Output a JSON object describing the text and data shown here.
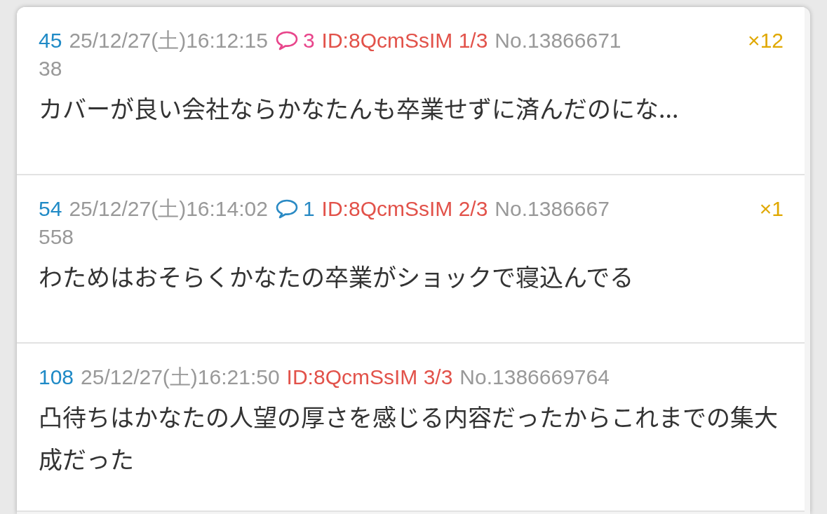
{
  "posts": [
    {
      "number": "45",
      "date": "25/12/27(土)16:12:15",
      "replies": {
        "count": "3",
        "color": "#e8458b"
      },
      "id": "ID:8QcmSsIM",
      "id_count": "1/3",
      "no": "No.13866671",
      "no_rest": "38",
      "badge": "×12",
      "body": "カバーが良い会社ならかなたんも卒業せずに済んだのにな..."
    },
    {
      "number": "54",
      "date": "25/12/27(土)16:14:02",
      "replies": {
        "count": "1",
        "color": "#2a8ac4"
      },
      "id": "ID:8QcmSsIM",
      "id_count": "2/3",
      "no": "No.1386667",
      "no_rest": "558",
      "badge": "×1",
      "body": "わためはおそらくかなたの卒業がショックで寝込んでる"
    },
    {
      "number": "108",
      "date": "25/12/27(土)16:21:50",
      "id": "ID:8QcmSsIM",
      "id_count": "3/3",
      "no": "No.1386669764",
      "body": "凸待ちはかなたの人望の厚さを感じる内容だったからこれまでの集大成だった"
    }
  ]
}
